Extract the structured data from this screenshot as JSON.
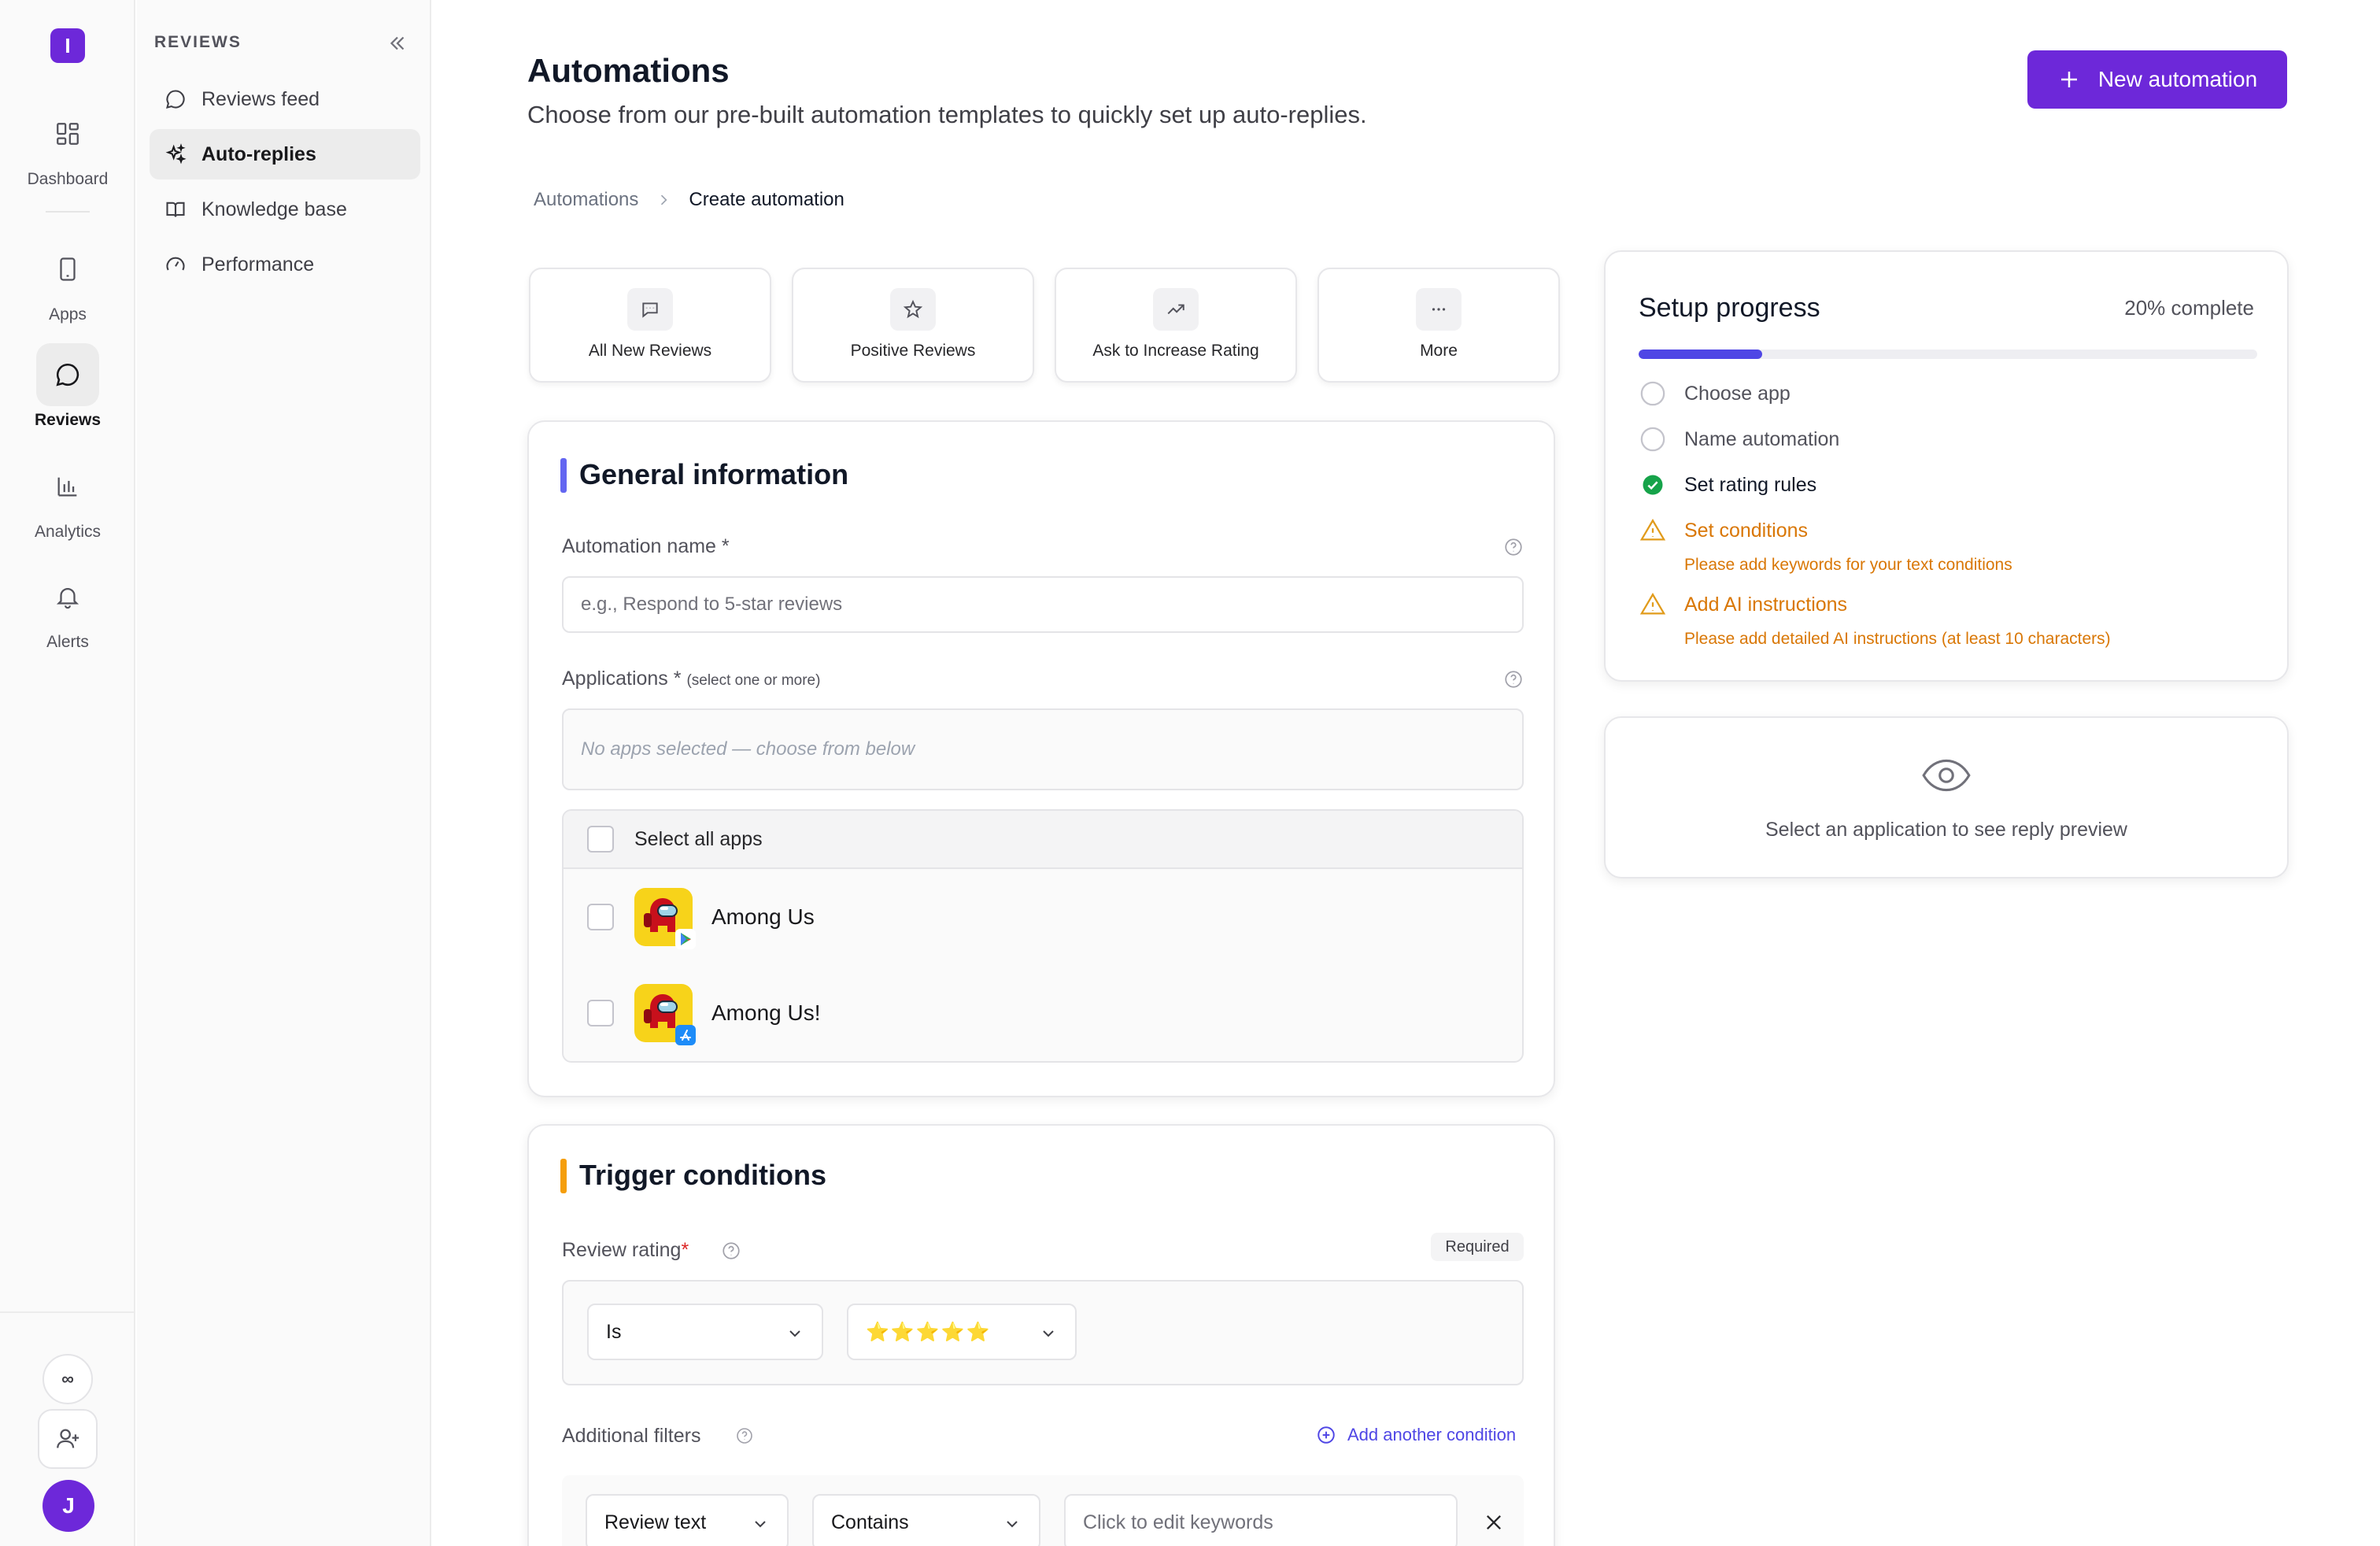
{
  "rail": {
    "logo_letter": "I",
    "items": [
      {
        "label": "Dashboard",
        "icon": "dashboard-icon"
      },
      {
        "label": "Apps",
        "icon": "phone-icon"
      },
      {
        "label": "Reviews",
        "icon": "chat-bubble-icon",
        "active": true
      },
      {
        "label": "Analytics",
        "icon": "bar-chart-icon"
      },
      {
        "label": "Alerts",
        "icon": "bell-icon"
      }
    ],
    "infinity_symbol": "∞",
    "avatar_letter": "J"
  },
  "sidebar": {
    "title": "REVIEWS",
    "items": [
      {
        "label": "Reviews feed",
        "icon": "chat-bubble-icon"
      },
      {
        "label": "Auto-replies",
        "icon": "sparkles-icon",
        "active": true
      },
      {
        "label": "Knowledge base",
        "icon": "book-icon"
      },
      {
        "label": "Performance",
        "icon": "gauge-icon"
      }
    ]
  },
  "header": {
    "title": "Automations",
    "subtitle": "Choose from our pre-built automation templates to quickly set up auto-replies.",
    "new_button_label": "New automation"
  },
  "breadcrumb": {
    "parent": "Automations",
    "current": "Create automation"
  },
  "templates": [
    {
      "label": "All New Reviews",
      "icon": "message-icon"
    },
    {
      "label": "Positive Reviews",
      "icon": "star-icon"
    },
    {
      "label": "Ask to Increase Rating",
      "icon": "trending-up-icon"
    },
    {
      "label": "More",
      "icon": "ellipsis-icon"
    }
  ],
  "general": {
    "title": "General information",
    "name_label": "Automation name *",
    "name_placeholder": "e.g., Respond to 5-star reviews",
    "apps_label": "Applications *",
    "apps_hint": "(select one or more)",
    "apps_empty": "No apps selected — choose from below",
    "select_all": "Select all apps",
    "apps": [
      {
        "name": "Among Us",
        "store": "google-play"
      },
      {
        "name": "Among Us!",
        "store": "app-store"
      }
    ],
    "accent_color": "#6366f1"
  },
  "trigger": {
    "title": "Trigger conditions",
    "rating_label": "Review rating",
    "required_badge": "Required",
    "operator": "Is",
    "stars": "⭐⭐⭐⭐⭐",
    "filters_label": "Additional filters",
    "add_condition": "Add another condition",
    "filter_field": "Review text",
    "filter_operator": "Contains",
    "keywords_placeholder": "Click to edit keywords",
    "accent_color": "#f59e0b"
  },
  "progress": {
    "title": "Setup progress",
    "percent_label": "20% complete",
    "percent": 20,
    "steps": [
      {
        "label": "Choose app",
        "status": "pending"
      },
      {
        "label": "Name automation",
        "status": "pending"
      },
      {
        "label": "Set rating rules",
        "status": "done"
      },
      {
        "label": "Set conditions",
        "status": "warning",
        "note": "Please add keywords for your text conditions"
      },
      {
        "label": "Add AI instructions",
        "status": "warning",
        "note": "Please add detailed AI instructions (at least 10 characters)"
      }
    ]
  },
  "preview": {
    "icon": "eye-icon",
    "text": "Select an application to see reply preview"
  }
}
